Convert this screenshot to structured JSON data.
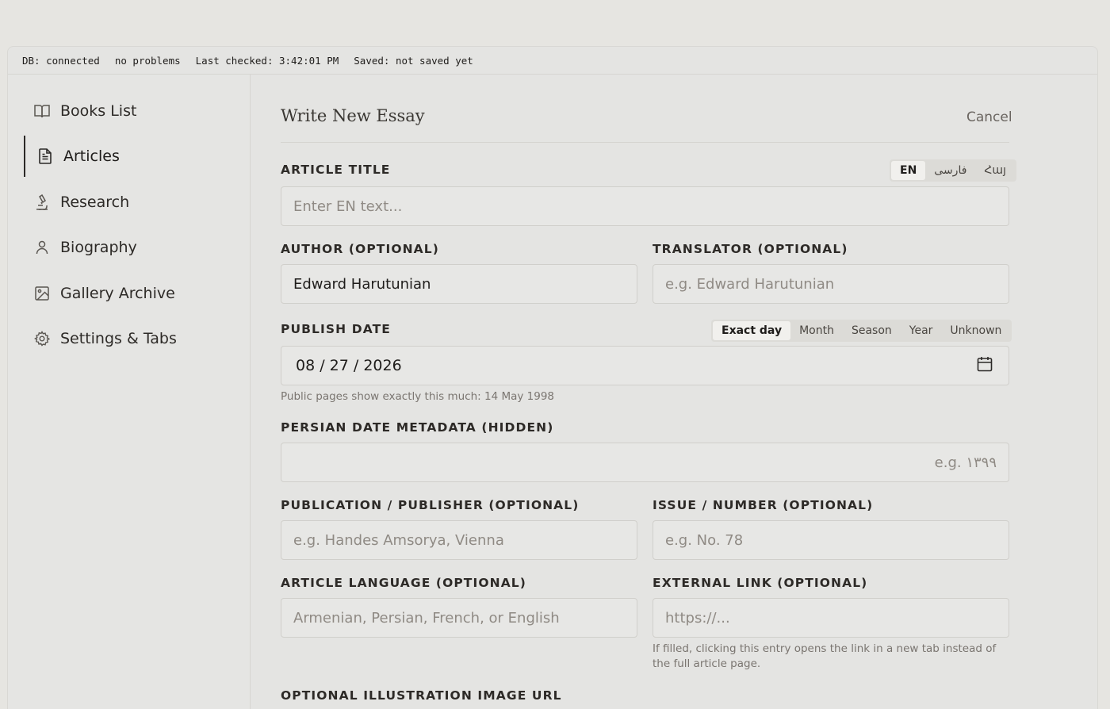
{
  "status": {
    "db": "DB: connected",
    "problems": "no problems",
    "last_checked": "Last checked: 3:42:01 PM",
    "saved": "Saved: not saved yet"
  },
  "sidebar": {
    "items": [
      {
        "label": "Books List",
        "icon": "book-open-icon",
        "active": false
      },
      {
        "label": "Articles",
        "icon": "document-icon",
        "active": true
      },
      {
        "label": "Research",
        "icon": "microscope-icon",
        "active": false
      },
      {
        "label": "Biography",
        "icon": "person-icon",
        "active": false
      },
      {
        "label": "Gallery Archive",
        "icon": "image-icon",
        "active": false
      },
      {
        "label": "Settings & Tabs",
        "icon": "gear-icon",
        "active": false
      }
    ]
  },
  "form": {
    "title": "Write New Essay",
    "cancel_label": "Cancel",
    "article_title": {
      "label": "ARTICLE TITLE",
      "placeholder": "Enter EN text...",
      "languages": [
        "EN",
        "فارسی",
        "Հայ"
      ],
      "selected_language": "EN"
    },
    "author": {
      "label": "AUTHOR (OPTIONAL)",
      "value": "Edward Harutunian"
    },
    "translator": {
      "label": "TRANSLATOR (OPTIONAL)",
      "placeholder": "e.g. Edward Harutunian"
    },
    "publish_date": {
      "label": "PUBLISH DATE",
      "value": "08 / 27 / 2026",
      "precision_options": [
        "Exact day",
        "Month",
        "Season",
        "Year",
        "Unknown"
      ],
      "selected_precision": "Exact day",
      "help": "Public pages show exactly this much: 14 May 1998"
    },
    "persian_date": {
      "label": "PERSIAN DATE METADATA (HIDDEN)",
      "placeholder": "e.g. ۱۳۹۹"
    },
    "publication": {
      "label": "PUBLICATION / PUBLISHER (OPTIONAL)",
      "placeholder": "e.g. Handes Amsorya, Vienna"
    },
    "issue": {
      "label": "ISSUE / NUMBER (OPTIONAL)",
      "placeholder": "e.g. No. 78"
    },
    "language": {
      "label": "ARTICLE LANGUAGE (OPTIONAL)",
      "placeholder": "Armenian, Persian, French, or English"
    },
    "external_link": {
      "label": "EXTERNAL LINK (OPTIONAL)",
      "placeholder": "https://...",
      "help": "If filled, clicking this entry opens the link in a new tab instead of the full article page."
    },
    "illustration": {
      "label": "OPTIONAL ILLUSTRATION IMAGE URL"
    }
  }
}
